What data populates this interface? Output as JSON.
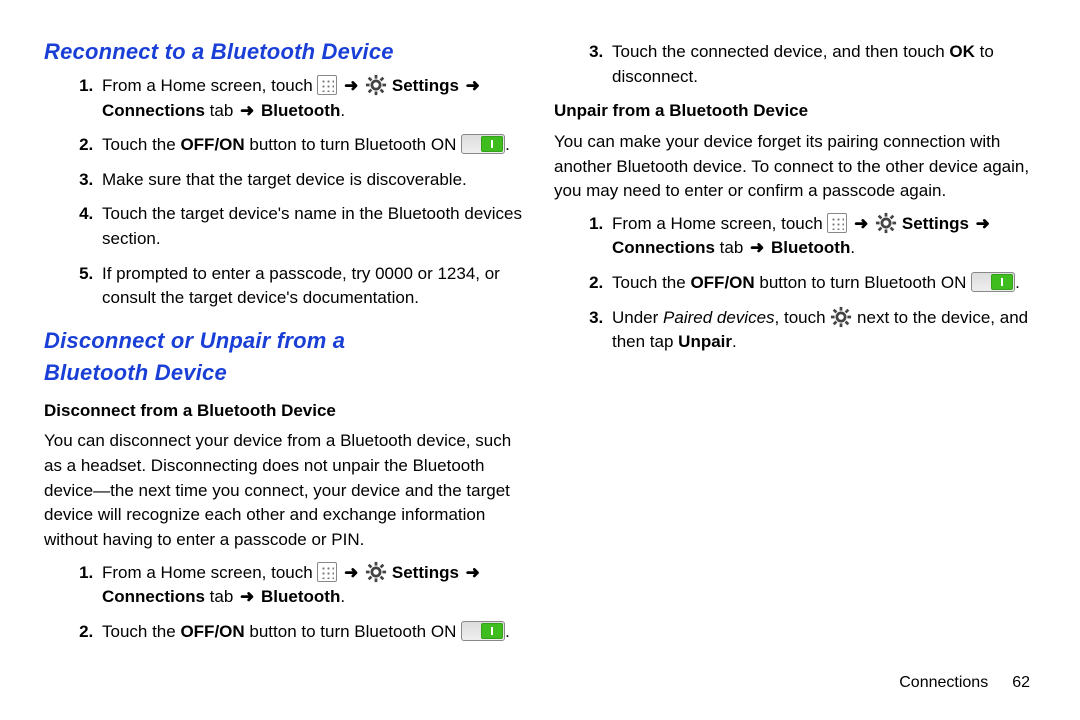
{
  "col1": {
    "heading1": "Reconnect to a Bluetooth Device",
    "steps1": {
      "s1a": "From a Home screen, touch ",
      "s1b": " Settings ",
      "s1c": "Connections",
      "s1d": " tab ",
      "s1e": " Bluetooth",
      "s1f": ".",
      "s2a": "Touch the ",
      "s2b": "OFF/ON",
      "s2c": " button to turn Bluetooth ON ",
      "s2d": ".",
      "s3": "Make sure that the target device is discoverable.",
      "s4": "Touch the target device's name in the Bluetooth devices section.",
      "s5": "If prompted to enter a passcode, try 0000 or 1234, or consult the target device's documentation."
    },
    "heading2a": "Disconnect or Unpair from a",
    "heading2b": "Bluetooth Device",
    "subheadA": "Disconnect from a Bluetooth Device",
    "paraA": "You can disconnect your device from a Bluetooth device, such as a headset. Disconnecting does not unpair the Bluetooth device—the next time you connect, your device and the target device will recognize each other and exchange information without having to enter a passcode or PIN.",
    "stepsA": {
      "s1a": "From a Home screen, touch ",
      "s1b": " Settings ",
      "s1c": "Connections",
      "s1d": " tab ",
      "s1e": " Bluetooth",
      "s1f": ".",
      "s2a": "Touch the ",
      "s2b": "OFF/ON",
      "s2c": " button to turn Bluetooth ON ",
      "s2d": "."
    }
  },
  "col2": {
    "stepsAcontA": "Touch the connected device, and then touch ",
    "stepsAcontB": "OK",
    "stepsAcontC": " to disconnect.",
    "subheadB": "Unpair from a Bluetooth Device",
    "paraB": "You can make your device forget its pairing connection with another Bluetooth device. To connect to the other device again, you may need to enter or confirm a passcode again.",
    "stepsB": {
      "s1a": "From a Home screen, touch ",
      "s1b": " Settings ",
      "s1c": "Connections",
      "s1d": " tab ",
      "s1e": " Bluetooth",
      "s1f": ".",
      "s2a": "Touch the ",
      "s2b": "OFF/ON",
      "s2c": " button to turn Bluetooth ON ",
      "s2d": ".",
      "s3a": "Under ",
      "s3b": "Paired devices",
      "s3c": ", touch ",
      "s3d": " next to the device, and then tap ",
      "s3e": "Unpair",
      "s3f": "."
    }
  },
  "footer": {
    "section": "Connections",
    "page": "62"
  },
  "glyph": {
    "arrow": "➜"
  }
}
